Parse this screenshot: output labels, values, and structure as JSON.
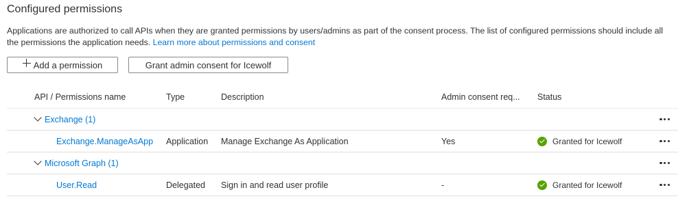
{
  "section": {
    "title": "Configured permissions",
    "description": "Applications are authorized to call APIs when they are granted permissions by users/admins as part of the consent process. The list of configured permissions should include all the permissions the application needs.",
    "learn_more": "Learn more about permissions and consent"
  },
  "toolbar": {
    "add_label": "Add a permission",
    "grant_label": "Grant admin consent for Icewolf"
  },
  "table": {
    "columns": [
      "API / Permissions name",
      "Type",
      "Description",
      "Admin consent req...",
      "Status"
    ],
    "groups": [
      {
        "name": "Exchange (1)",
        "permissions": [
          {
            "name": "Exchange.ManageAsApp",
            "type": "Application",
            "description": "Manage Exchange As Application",
            "admin_consent": "Yes",
            "status": "Granted for Icewolf"
          }
        ]
      },
      {
        "name": "Microsoft Graph (1)",
        "permissions": [
          {
            "name": "User.Read",
            "type": "Delegated",
            "description": "Sign in and read user profile",
            "admin_consent": "-",
            "status": "Granted for Icewolf"
          }
        ]
      }
    ]
  },
  "icons": {
    "add": "plus-icon",
    "expand": "chevron-down-icon",
    "status": "check-circle-icon",
    "more": "more-icon"
  },
  "colors": {
    "link": "#0078d4",
    "granted": "#57a300",
    "text": "#323130"
  }
}
